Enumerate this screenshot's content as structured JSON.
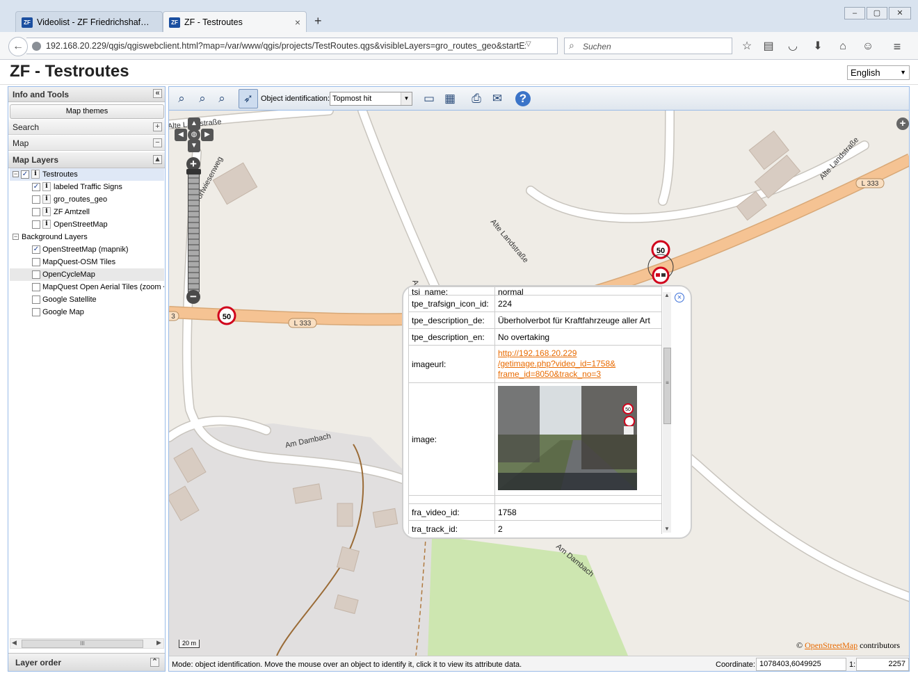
{
  "browser": {
    "tabs": [
      {
        "label": "Videolist - ZF Friedrichshaf…",
        "close": "×"
      },
      {
        "label": "ZF - Testroutes",
        "close": "×"
      }
    ],
    "new_tab": "+",
    "favicon": "ZF",
    "window_buttons": [
      "–",
      "▢",
      "✕"
    ],
    "url": "192.168.20.229/qgis/qgiswebclient.html?map=/var/www/qgis/projects/TestRoutes.qgs&visibleLayers=gro_routes_geo&startExter",
    "search_placeholder": "Suchen",
    "icons": [
      "back-icon",
      "reload-icon",
      "search-icon",
      "bookmark-star-icon",
      "reading-list-icon",
      "pocket-icon",
      "download-icon",
      "home-icon",
      "chat-icon",
      "menu-icon"
    ]
  },
  "app": {
    "title": "ZF - Testroutes",
    "language": "English"
  },
  "left": {
    "info_tools": "Info and Tools",
    "collapse": "«",
    "map_themes": "Map themes",
    "search": "Search",
    "search_btn": "+",
    "map": "Map",
    "map_btn": "−",
    "map_layers": "Map Layers",
    "map_layers_btn": "▴",
    "tree": [
      {
        "label": "Testroutes",
        "checked": true,
        "info": true,
        "expander": "−",
        "level": 0
      },
      {
        "label": "labeled Traffic Signs",
        "checked": true,
        "info": true,
        "level": 1
      },
      {
        "label": "gro_routes_geo",
        "checked": false,
        "info": true,
        "level": 1
      },
      {
        "label": "ZF Amtzell",
        "checked": false,
        "info": true,
        "level": 1
      },
      {
        "label": "OpenStreetMap",
        "checked": false,
        "info": true,
        "level": 1
      }
    ],
    "background_group": "Background Layers",
    "background_expander": "−",
    "background": [
      {
        "label": "OpenStreetMap (mapnik)",
        "checked": true
      },
      {
        "label": "MapQuest-OSM Tiles",
        "checked": false
      },
      {
        "label": "OpenCycleMap",
        "checked": false
      },
      {
        "label": "MapQuest Open Aerial Tiles (zoom <",
        "checked": false
      },
      {
        "label": "Google Satellite",
        "checked": false
      },
      {
        "label": "Google Map",
        "checked": false
      }
    ],
    "scroll_grip": "III",
    "layer_order": "Layer order",
    "layer_order_btn": "⌃"
  },
  "toolbar": {
    "object_identification_label": "Object identification:",
    "object_identification_value": "Topmost hit"
  },
  "map": {
    "street_labels": {
      "alte_landstrasse_1": "Alte Landstraße",
      "alte_landstrasse_2": "Alte Landstraße",
      "alte_landstrasse_3": "Alte Landstraße",
      "dorfwiesenweg": "Dorfwiesenweg",
      "am_dorf": "Am Dorf",
      "am_dambach_1": "Am Dambach",
      "am_dambach_2": "Am Dambach",
      "l333_1": "L 333",
      "l333_2": "L 333",
      "l333_3": "3"
    },
    "speed_sign_1": "50",
    "speed_sign_2": "50",
    "scale": "20 m",
    "plus": "+",
    "attribution_prefix": "© ",
    "attribution_link": "OpenStreetMap",
    "attribution_suffix": " contributors"
  },
  "popup": {
    "close": "×",
    "partial_key": "tsi_name:",
    "partial_value": "normal",
    "rows": [
      {
        "key": "tpe_trafsign_icon_id:",
        "value": "224"
      },
      {
        "key": "tpe_description_de:",
        "value": "Überholverbot für Kraftfahrzeuge aller Art"
      },
      {
        "key": "tpe_description_en:",
        "value": "No overtaking"
      }
    ],
    "imageurl_key": "imageurl:",
    "imageurl_lines": [
      "http://192.168.20.229",
      "/getimage.php?video_id=1758&",
      "frame_id=8050&track_no=3"
    ],
    "image_key": "image:",
    "rows_after": [
      {
        "key": "fra_video_id:",
        "value": "1758"
      },
      {
        "key": "tra_track_id:",
        "value": "2"
      }
    ],
    "photo_sign": "50"
  },
  "status": {
    "message": "Mode: object identification. Move the mouse over an object to identify it, click it to view its attribute data.",
    "coordinate_label": "Coordinate:",
    "coordinate_value": "1078403,6049925",
    "scale_label": "1:",
    "scale_value": "2257"
  }
}
